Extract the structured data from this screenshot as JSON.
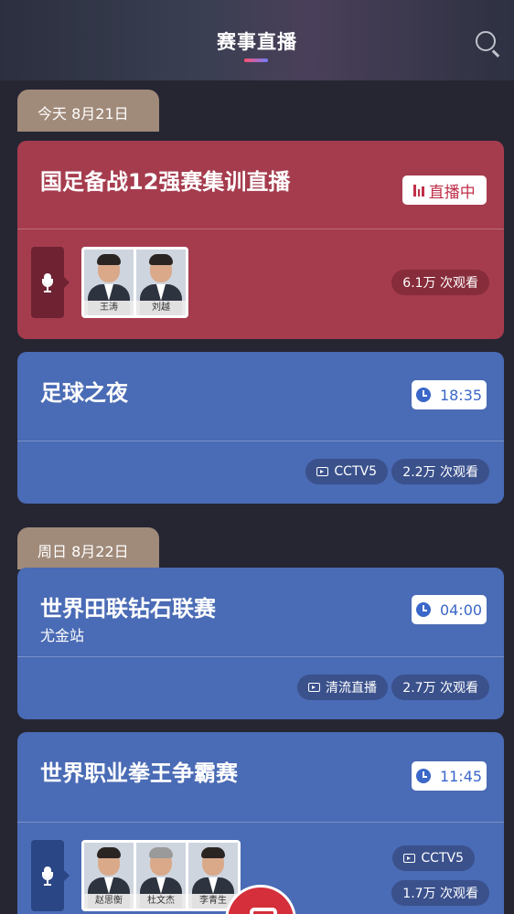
{
  "header": {
    "title": "赛事直播"
  },
  "sections": [
    {
      "date_label": "今天 8月21日"
    },
    {
      "date_label": "周日 8月22日"
    }
  ],
  "cards": [
    {
      "title": "国足备战12强赛集训直播",
      "status_label": "直播中",
      "views": "6.1万 次观看",
      "hosts": [
        "王涛",
        "刘越"
      ]
    },
    {
      "title": "足球之夜",
      "time": "18:35",
      "channel": "CCTV5",
      "views": "2.2万 次观看"
    },
    {
      "title": "世界田联钻石联赛",
      "subtitle": "尤金站",
      "time": "04:00",
      "channel": "清流直播",
      "views": "2.7万 次观看"
    },
    {
      "title": "世界职业拳王争霸赛",
      "time": "11:45",
      "channel": "CCTV5",
      "views": "1.7万 次观看",
      "hosts": [
        "赵思衡",
        "杜文杰",
        "李青生"
      ]
    }
  ],
  "colors": {
    "live_card": "#a53c4e",
    "scheduled_card": "#4a6bb5",
    "date_tab": "#a08a79",
    "background": "#262633"
  },
  "icons": [
    "search-icon",
    "live-bars-icon",
    "clock-icon",
    "tv-icon",
    "mic-icon"
  ]
}
